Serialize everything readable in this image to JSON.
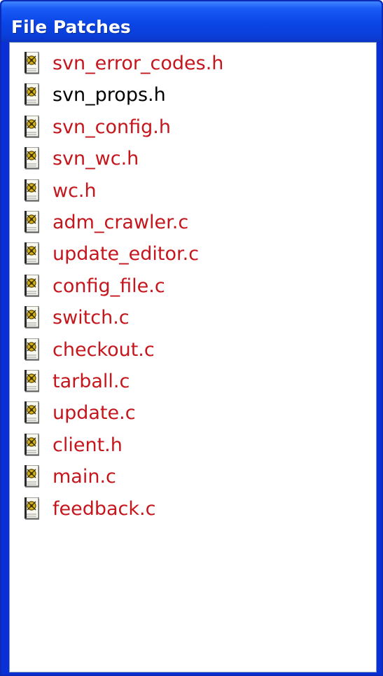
{
  "window": {
    "title": "File Patches"
  },
  "files": [
    {
      "name": "svn_error_codes.h",
      "color": "#c4161c"
    },
    {
      "name": "svn_props.h",
      "color": "#000000"
    },
    {
      "name": "svn_config.h",
      "color": "#c4161c"
    },
    {
      "name": "svn_wc.h",
      "color": "#c4161c"
    },
    {
      "name": "wc.h",
      "color": "#c4161c"
    },
    {
      "name": "adm_crawler.c",
      "color": "#c4161c"
    },
    {
      "name": "update_editor.c",
      "color": "#c4161c"
    },
    {
      "name": "config_file.c",
      "color": "#c4161c"
    },
    {
      "name": "switch.c",
      "color": "#c4161c"
    },
    {
      "name": "checkout.c",
      "color": "#c4161c"
    },
    {
      "name": "tarball.c",
      "color": "#c4161c"
    },
    {
      "name": "update.c",
      "color": "#c4161c"
    },
    {
      "name": "client.h",
      "color": "#c4161c"
    },
    {
      "name": "main.c",
      "color": "#c4161c"
    },
    {
      "name": "feedback.c",
      "color": "#c4161c"
    }
  ],
  "icon": "patch-file-icon"
}
